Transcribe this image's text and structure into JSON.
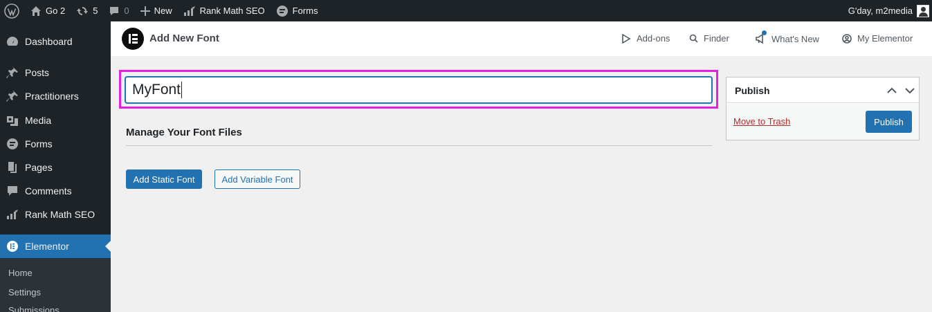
{
  "admin_bar": {
    "site_name": "Go 2",
    "updates_count": "5",
    "comments_count": "0",
    "new_label": "New",
    "rank_math_label": "Rank Math SEO",
    "forms_label": "Forms",
    "greeting": "G'day, m2media"
  },
  "sidebar": {
    "items": [
      {
        "label": "Dashboard",
        "icon": "dashboard-icon"
      },
      {
        "label": "Posts",
        "icon": "pin-icon"
      },
      {
        "label": "Practitioners",
        "icon": "pin-icon"
      },
      {
        "label": "Media",
        "icon": "media-icon"
      },
      {
        "label": "Forms",
        "icon": "forms-icon"
      },
      {
        "label": "Pages",
        "icon": "pages-icon"
      },
      {
        "label": "Comments",
        "icon": "comments-icon"
      },
      {
        "label": "Rank Math SEO",
        "icon": "rank-math-icon"
      },
      {
        "label": "Elementor",
        "icon": "elementor-icon",
        "active": true
      }
    ],
    "submenu": [
      "Home",
      "Settings",
      "Submissions"
    ]
  },
  "topbar": {
    "page_title": "Add New Font",
    "addons_label": "Add-ons",
    "finder_label": "Finder",
    "whats_new_label": "What's New",
    "my_elementor_label": "My Elementor"
  },
  "editor": {
    "font_title_value": "MyFont",
    "section_title": "Manage Your Font Files",
    "add_static_label": "Add Static Font",
    "add_variable_label": "Add Variable Font"
  },
  "publish_box": {
    "title": "Publish",
    "trash_label": "Move to Trash",
    "publish_label": "Publish"
  },
  "colors": {
    "admin_dark": "#1d2327",
    "accent_blue": "#2271b1",
    "highlight_magenta": "#e41fe0",
    "trash_red": "#b32d2e"
  }
}
